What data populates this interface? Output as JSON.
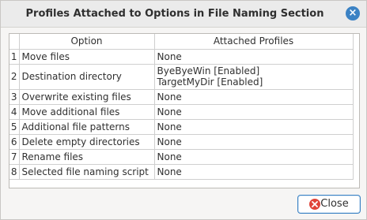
{
  "window": {
    "title": "Profiles Attached to Options in File Naming Section",
    "close_glyph": "×"
  },
  "table": {
    "headers": {
      "number": "",
      "option": "Option",
      "profiles": "Attached Profiles"
    },
    "rows": [
      {
        "number": "1",
        "option": "Move files",
        "profiles": [
          "None"
        ]
      },
      {
        "number": "2",
        "option": "Destination directory",
        "profiles": [
          "ByeByeWin [Enabled]",
          "TargetMyDir [Enabled]"
        ]
      },
      {
        "number": "3",
        "option": "Overwrite existing files",
        "profiles": [
          "None"
        ]
      },
      {
        "number": "4",
        "option": "Move additional files",
        "profiles": [
          "None"
        ]
      },
      {
        "number": "5",
        "option": "Additional file patterns",
        "profiles": [
          "None"
        ]
      },
      {
        "number": "6",
        "option": "Delete empty directories",
        "profiles": [
          "None"
        ]
      },
      {
        "number": "7",
        "option": "Rename files",
        "profiles": [
          "None"
        ]
      },
      {
        "number": "8",
        "option": "Selected file naming script",
        "profiles": [
          "None"
        ]
      }
    ]
  },
  "footer": {
    "close_label": "Close",
    "close_icon": "close-icon"
  },
  "colors": {
    "accent": "#3b82c4",
    "close_icon": "#e0443a",
    "window_bg": "#f6f5f4",
    "table_bg": "#ffffff"
  }
}
